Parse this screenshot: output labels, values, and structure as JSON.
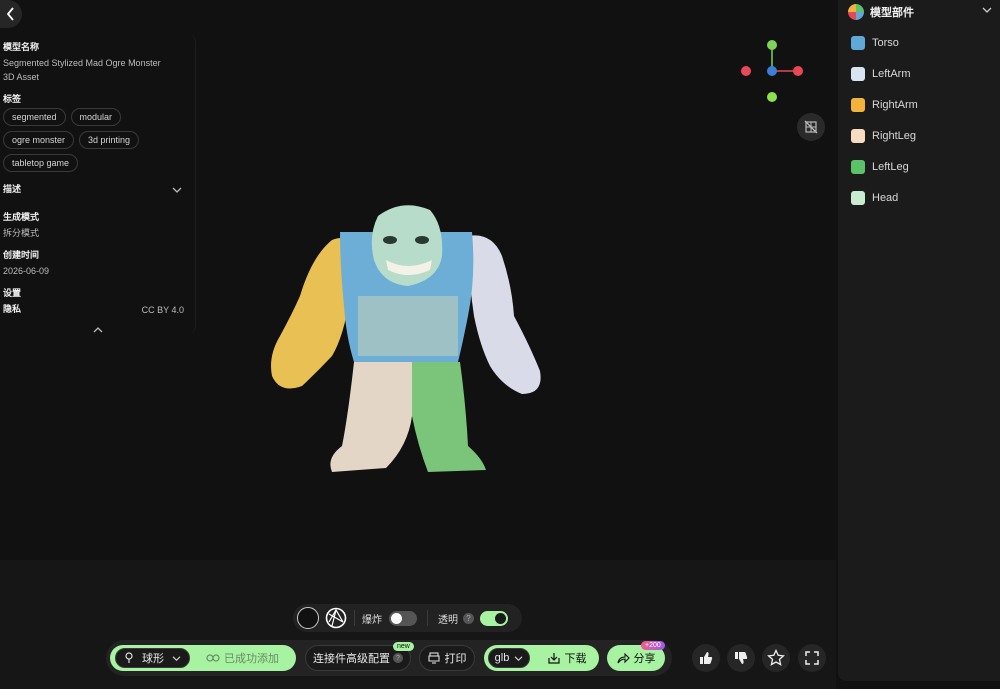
{
  "nav": {
    "back_icon": "chevron-left-icon"
  },
  "info": {
    "name_label": "模型名称",
    "name_value": "Segmented Stylized Mad Ogre Monster",
    "type_value": "3D Asset",
    "tags_label": "标签",
    "tags": [
      "segmented",
      "modular",
      "ogre monster",
      "3d printing",
      "tabletop game"
    ],
    "desc_label": "描述",
    "mode_label": "生成模式",
    "mode_value": "拆分模式",
    "created_label": "创建时间",
    "created_value": "2026-06-09",
    "settings_label": "设置",
    "privacy_label": "隐私",
    "privacy_value": "CC BY 4.0"
  },
  "parts_panel": {
    "title": "模型部件",
    "parts": [
      {
        "label": "Torso",
        "color": "#5fa8d8"
      },
      {
        "label": "LeftArm",
        "color": "#d8e4f2"
      },
      {
        "label": "RightArm",
        "color": "#f2b23c"
      },
      {
        "label": "RightLeg",
        "color": "#f6dcc0"
      },
      {
        "label": "LeftLeg",
        "color": "#5cc26a"
      },
      {
        "label": "Head",
        "color": "#c9ecce"
      }
    ]
  },
  "view_bar": {
    "explode_label": "爆炸",
    "explode_on": false,
    "transparent_label": "透明",
    "transparent_on": true
  },
  "toolbar": {
    "shape_label": "球形",
    "added_label": "已成功添加",
    "connector_label": "连接件高级配置",
    "new_badge": "new",
    "print_label": "打印",
    "format_value": "glb",
    "download_label": "下载",
    "share_label": "分享",
    "share_badge": "+200"
  },
  "colors": {
    "accent": "#a7f3a1",
    "panel": "#1b1b1b",
    "background": "#111111"
  }
}
